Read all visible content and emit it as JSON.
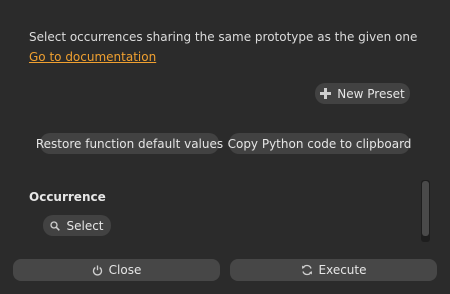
{
  "description": "Select occurrences sharing the same prototype as the given one",
  "doc_link": "Go to documentation",
  "preset": {
    "new_preset_label": "New Preset"
  },
  "actions": {
    "restore_label": "Restore function default values",
    "copy_label": "Copy Python code to clipboard"
  },
  "occurrence": {
    "title": "Occurrence",
    "select_label": "Select"
  },
  "footer": {
    "close_label": "Close",
    "execute_label": "Execute"
  },
  "icons": {
    "new_preset": "plus-icon",
    "select": "search-icon",
    "close": "power-icon",
    "execute": "refresh-icon"
  },
  "colors": {
    "background": "#2b2b2b",
    "link": "#f0a030",
    "button": "#424242"
  }
}
